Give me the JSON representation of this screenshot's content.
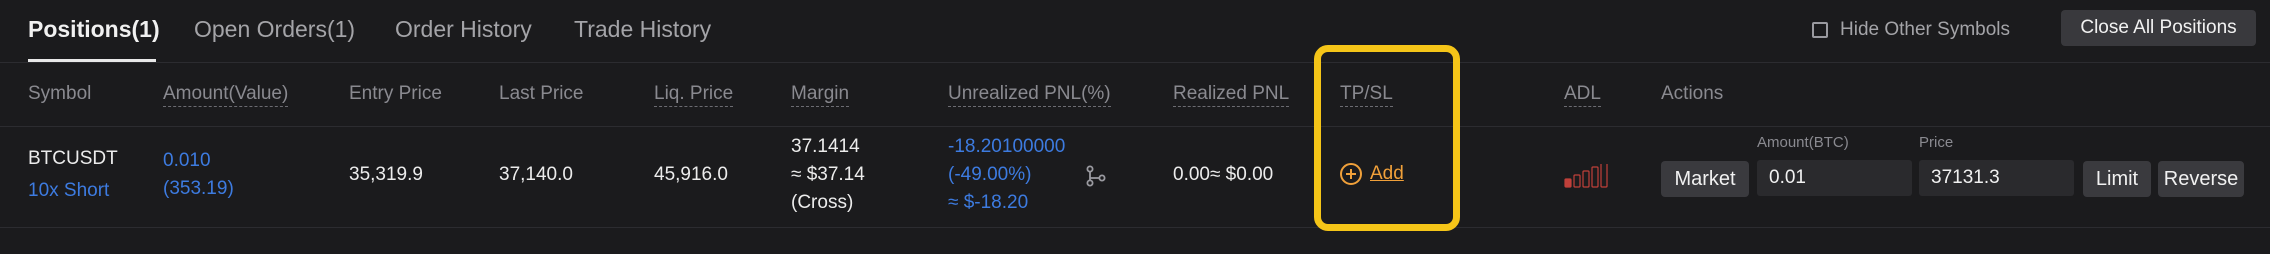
{
  "tabs": [
    {
      "label": "Positions(1)",
      "active": true
    },
    {
      "label": "Open Orders(1)",
      "active": false
    },
    {
      "label": "Order History",
      "active": false
    },
    {
      "label": "Trade History",
      "active": false
    }
  ],
  "hide_other_symbols": {
    "label": "Hide Other Symbols",
    "checked": false
  },
  "close_all_label": "Close All Positions",
  "columns": {
    "symbol": "Symbol",
    "amount": "Amount(Value)",
    "entry_price": "Entry Price",
    "last_price": "Last Price",
    "liq_price": "Liq. Price",
    "margin": "Margin",
    "unrealized_pnl": "Unrealized PNL(%)",
    "realized_pnl": "Realized PNL",
    "tpsl": "TP/SL",
    "adl": "ADL",
    "actions": "Actions"
  },
  "position": {
    "symbol": "BTCUSDT",
    "leverage_side": "10x Short",
    "amount": "0.010",
    "value": "(353.19)",
    "entry_price": "35,319.9",
    "last_price": "37,140.0",
    "liq_price": "45,916.0",
    "margin_amount": "37.1414",
    "margin_value": "≈ $37.14",
    "margin_mode": "(Cross)",
    "unrealized_pnl": "-18.20100000",
    "unrealized_pct": "(-49.00%)",
    "unrealized_usd": "≈ $-18.20",
    "realized_pnl": "0.00≈ $0.00",
    "tpsl_add_label": "Add",
    "adl_level": 1,
    "adl_total": 5,
    "actions": {
      "market_label": "Market",
      "amount_label": "Amount(BTC)",
      "amount_value": "0.01",
      "price_label": "Price",
      "price_value": "37131.3",
      "limit_label": "Limit",
      "reverse_label": "Reverse"
    }
  },
  "colors": {
    "accent_blue": "#3d7be0",
    "accent_orange": "#f0a03a",
    "highlight": "#f5c518"
  }
}
